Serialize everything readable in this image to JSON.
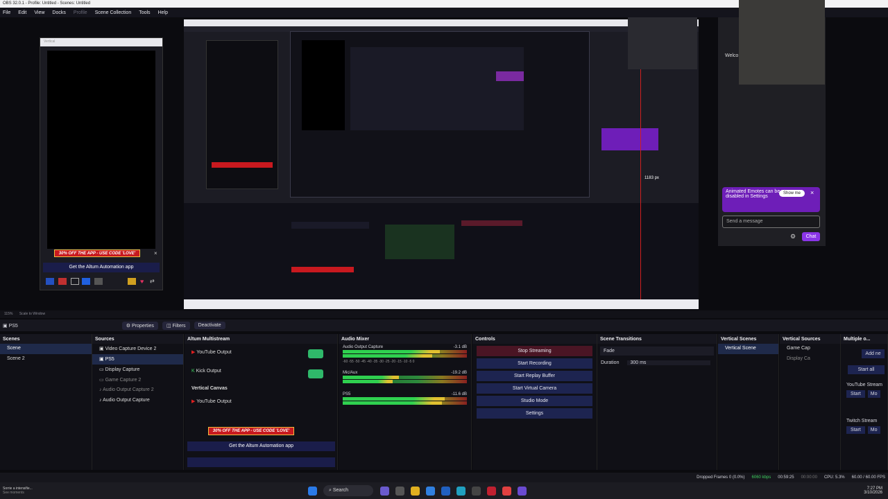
{
  "window_title": "OBS 32.0.1 - Profile: Untitled - Scenes: Untitled",
  "menu": [
    "File",
    "Edit",
    "View",
    "Docks",
    "Profile",
    "Scene Collection",
    "Tools",
    "Help"
  ],
  "vertical_canvas_title": "Vertical",
  "promo_text": "30% OFF THE APP - USE CODE 'LOVE'",
  "altum_app_text": "Get the Altum Automation app",
  "chat_overlay": {
    "popup_text": "Animated Emotes can be disabled in Settings",
    "show_me": "Show me",
    "send_placeholder": "Send a message",
    "chat_button": "Chat",
    "partial_welcome": "Welco",
    "px_label": "1183 px"
  },
  "scale_bar": {
    "zoom": "115%",
    "scale_mode": "Scale to Window"
  },
  "source_toolbar": {
    "current": "PS5",
    "properties": "Properties",
    "filters": "Filters",
    "deactivate": "Deactivate"
  },
  "docks": {
    "scenes": {
      "title": "Scenes",
      "items": [
        "Scene",
        "Scene 2"
      ]
    },
    "sources": {
      "title": "Sources",
      "items": [
        "Video Capture Device 2",
        "PS5",
        "Display Capture",
        "Game Capture 2",
        "Audio Output Capture 2",
        "Audio Output Capture"
      ]
    },
    "altum": {
      "title": "Altum Multistream",
      "outputs": [
        "YouTube Output",
        "Kick Output"
      ],
      "vertical_title": "Vertical Canvas",
      "vertical_outputs": [
        "YouTube Output"
      ]
    },
    "audio_mixer": {
      "title": "Audio Mixer",
      "channels": [
        {
          "name": "Audio Output Capture",
          "db": "-3.1 dB"
        },
        {
          "name": "Mic/Aux",
          "db": "-19.2 dB"
        },
        {
          "name": "PS5",
          "db": "-11.6 dB"
        }
      ],
      "scale": [
        "-60",
        "-55",
        "-50",
        "-45",
        "-40",
        "-35",
        "-30",
        "-25",
        "-20",
        "-15",
        "-10",
        "-5",
        "0"
      ]
    },
    "controls": {
      "title": "Controls",
      "buttons": [
        "Stop Streaming",
        "Start Recording",
        "Start Replay Buffer",
        "Start Virtual Camera",
        "Studio Mode",
        "Settings"
      ]
    },
    "transitions": {
      "title": "Scene Transitions",
      "type": "Fade",
      "duration_label": "Duration",
      "duration_value": "300 ms"
    },
    "vertical_scenes": {
      "title": "Vertical Scenes",
      "items": [
        "Vertical Scene"
      ]
    },
    "vertical_sources": {
      "title": "Vertical Sources",
      "items": [
        "Game Cap",
        "Display Ca"
      ]
    },
    "multiple": {
      "title": "Multiple o...",
      "add": "Add ne",
      "start_all": "Start all",
      "streams": [
        "YouTube Stream",
        "Twitch Stream"
      ],
      "start": "Start",
      "more": "Mo"
    }
  },
  "status": {
    "dropped": "Dropped Frames 0 (0.0%)",
    "kbps": "6060 kbps",
    "live_time": "00:59:25",
    "rec_time": "00:00:00",
    "cpu": "CPU: 5.3%",
    "fps": "60.00 / 60.00 FPS"
  },
  "taskbar": {
    "notify_title": "Sorrie a intensifie...",
    "notify_sub": "See moments",
    "search": "Search",
    "time": "7:27 PM",
    "date": "3/10/2026"
  },
  "colors": {
    "accent_green": "#2fb86a",
    "promo_red": "#c8191f",
    "stop_stream": "#4a1524",
    "chat_purple": "#6e1eb8"
  }
}
